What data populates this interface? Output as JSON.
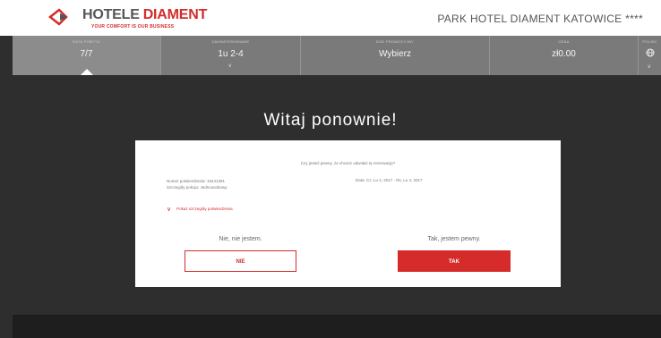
{
  "header": {
    "brand_first": "HOTELE",
    "brand_second": "DIAMENT",
    "tagline": "YOUR COMFORT IS OUR BUSINESS",
    "hotel_name": "PARK HOTEL DIAMENT KATOWICE ****"
  },
  "booking_bar": {
    "sections": [
      {
        "label": "DATA POBYTU",
        "value": "7/7"
      },
      {
        "label": "ZAKWATEROWANIE",
        "value": "1u 2-4"
      },
      {
        "label": "KOD PROMOCYJNY",
        "value": "Wybierz"
      },
      {
        "label": "CENA",
        "value": "zł0.00"
      },
      {
        "label": "POLSKI",
        "value": ""
      }
    ]
  },
  "modal": {
    "heading": "Witaj ponownie!",
    "message": "Czy jesteś pewny, że chcesz odwołać tę rezerwację?",
    "details_line1": "Numer potwierdzenia: 16441391",
    "details_line2": "Szczegóły pokoju: Jednoosobowy",
    "dates": "Data: Cz, Lu 2, 2017 - Ńs, Lu 4, 2017",
    "show_details": "Pokaż szczegóły potwierdzenia",
    "no_prompt": "Nie, nie jestem.",
    "yes_prompt": "Tak, jestem pewny.",
    "no_button": "NIE",
    "yes_button": "TAK"
  },
  "colors": {
    "accent": "#d52b2b",
    "bar": "#7a7a7a",
    "overlay": "#2e2e2e"
  }
}
